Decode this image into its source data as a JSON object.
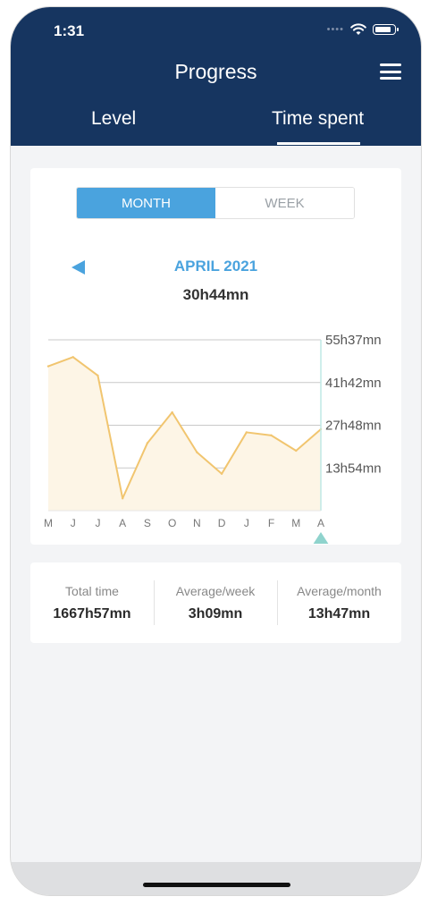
{
  "status": {
    "time": "1:31",
    "wifi_icon": "wifi-icon",
    "battery_icon": "battery-icon"
  },
  "header": {
    "title": "Progress",
    "menu_icon": "hamburger-menu-icon"
  },
  "tabs": [
    {
      "label": "Level"
    },
    {
      "label": "Time spent",
      "active": true
    }
  ],
  "segment": {
    "month": "MONTH",
    "week": "WEEK",
    "selected": "MONTH"
  },
  "period": {
    "label": "APRIL 2021",
    "total": "30h44mn"
  },
  "chart_data": {
    "type": "area",
    "categories": [
      "M",
      "J",
      "J",
      "A",
      "S",
      "O",
      "N",
      "D",
      "J",
      "F",
      "M",
      "A"
    ],
    "values_hours": [
      47,
      50,
      44,
      4,
      22,
      32,
      19,
      12,
      25.5,
      24.5,
      19.5,
      26.5
    ],
    "y_ticks": [
      "55h37mn",
      "41h42mn",
      "27h48mn",
      "13h54mn"
    ],
    "y_tick_values_hours": [
      55.62,
      41.7,
      27.8,
      13.9
    ],
    "ylim_hours": [
      0,
      55.62
    ],
    "selected_index": 11,
    "line_color": "#f1c56f",
    "fill_color": "#fdf5e6"
  },
  "stats": [
    {
      "label": "Total time",
      "value": "1667h57mn"
    },
    {
      "label": "Average/week",
      "value": "3h09mn"
    },
    {
      "label": "Average/month",
      "value": "13h47mn"
    }
  ],
  "colors": {
    "header": "#163560",
    "accent": "#4aa3de",
    "selector": "#8fd3cd"
  }
}
